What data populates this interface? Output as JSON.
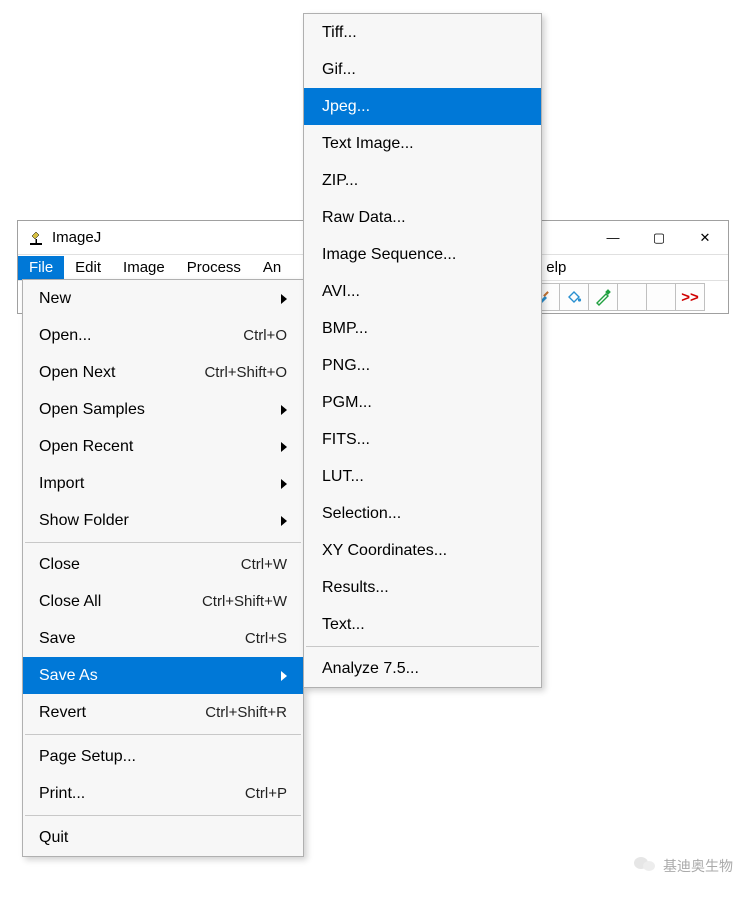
{
  "window": {
    "title": "ImageJ"
  },
  "win_buttons": {
    "min": "—",
    "max": "▢",
    "close": "✕"
  },
  "menubar": {
    "items": [
      "File",
      "Edit",
      "Image",
      "Process",
      "An",
      "elp"
    ],
    "selected": "File"
  },
  "toolbar": {
    "more": ">>"
  },
  "file_menu": {
    "items": [
      {
        "label": "New",
        "submenu": true
      },
      {
        "label": "Open...",
        "shortcut": "Ctrl+O"
      },
      {
        "label": "Open Next",
        "shortcut": "Ctrl+Shift+O"
      },
      {
        "label": "Open Samples",
        "submenu": true
      },
      {
        "label": "Open Recent",
        "submenu": true
      },
      {
        "label": "Import",
        "submenu": true
      },
      {
        "label": "Show Folder",
        "submenu": true
      },
      {
        "sep": true
      },
      {
        "label": "Close",
        "shortcut": "Ctrl+W"
      },
      {
        "label": "Close All",
        "shortcut": "Ctrl+Shift+W"
      },
      {
        "label": "Save",
        "shortcut": "Ctrl+S"
      },
      {
        "label": "Save As",
        "submenu": true,
        "selected": true
      },
      {
        "label": "Revert",
        "shortcut": "Ctrl+Shift+R"
      },
      {
        "sep": true
      },
      {
        "label": "Page Setup..."
      },
      {
        "label": "Print...",
        "shortcut": "Ctrl+P"
      },
      {
        "sep": true
      },
      {
        "label": "Quit"
      }
    ]
  },
  "saveas_menu": {
    "items": [
      {
        "label": "Tiff..."
      },
      {
        "label": "Gif..."
      },
      {
        "label": "Jpeg...",
        "selected": true
      },
      {
        "label": "Text Image..."
      },
      {
        "label": "ZIP..."
      },
      {
        "label": "Raw Data..."
      },
      {
        "label": "Image Sequence..."
      },
      {
        "label": "AVI..."
      },
      {
        "label": "BMP..."
      },
      {
        "label": "PNG..."
      },
      {
        "label": "PGM..."
      },
      {
        "label": "FITS..."
      },
      {
        "label": "LUT..."
      },
      {
        "label": "Selection..."
      },
      {
        "label": "XY Coordinates..."
      },
      {
        "label": "Results..."
      },
      {
        "label": "Text..."
      },
      {
        "sep": true
      },
      {
        "label": "Analyze 7.5..."
      }
    ]
  },
  "watermark": {
    "text": "基迪奥生物"
  }
}
